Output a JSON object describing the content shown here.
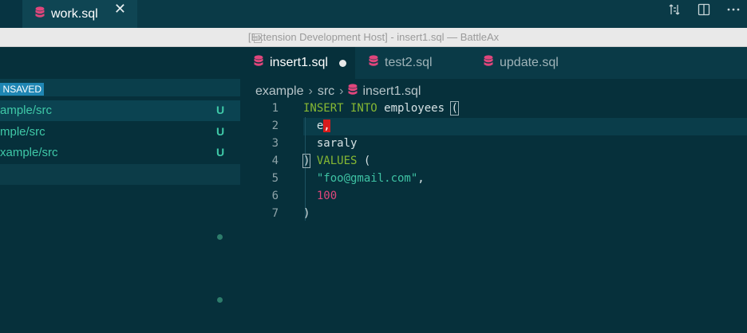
{
  "outer_window": {
    "tab": {
      "icon": "database-icon",
      "label": "work.sql",
      "close": "✕"
    },
    "actions": [
      "compare-changes-icon",
      "split-editor-icon",
      "more-actions-icon"
    ]
  },
  "title_bar": {
    "title": "[Extension Development Host] - insert1.sql — BattleAx"
  },
  "sidebar": {
    "badge": "NSAVED",
    "items": [
      {
        "path": "ample/src",
        "status": "U"
      },
      {
        "path": "mple/src",
        "status": "U"
      },
      {
        "path": "xample/src",
        "status": "U"
      }
    ]
  },
  "editor_tabs": [
    {
      "label": "insert1.sql",
      "active": true,
      "modified": true
    },
    {
      "label": "test2.sql",
      "active": false
    },
    {
      "label": "update.sql",
      "active": false
    }
  ],
  "breadcrumb": {
    "parts": [
      "example",
      "src",
      "insert1.sql"
    ]
  },
  "code": {
    "lines": [
      {
        "n": "1",
        "tokens": [
          [
            "kw",
            "INSERT INTO"
          ],
          [
            "plain",
            " employees "
          ],
          [
            "plain",
            "("
          ]
        ]
      },
      {
        "n": "2",
        "tokens": [
          [
            "plain",
            "  e"
          ],
          [
            "err",
            ","
          ]
        ]
      },
      {
        "n": "3",
        "tokens": [
          [
            "plain",
            "  saraly"
          ]
        ]
      },
      {
        "n": "4",
        "tokens": [
          [
            "plain",
            ")"
          ],
          [
            "kw",
            " VALUES"
          ],
          [
            "plain",
            " ("
          ]
        ]
      },
      {
        "n": "5",
        "tokens": [
          [
            "str",
            "  \"foo@gmail.com\""
          ],
          [
            "plain",
            ","
          ]
        ]
      },
      {
        "n": "6",
        "tokens": [
          [
            "num",
            "  100"
          ]
        ]
      },
      {
        "n": "7",
        "tokens": [
          [
            "plain",
            ")"
          ]
        ]
      }
    ]
  },
  "colors": {
    "keyword": "#86b833",
    "string": "#3ec2a3",
    "number": "#e0467c",
    "sql_icon": "#e0467c",
    "git_untracked": "#3fc9a8",
    "badge": "#1f86b3"
  }
}
